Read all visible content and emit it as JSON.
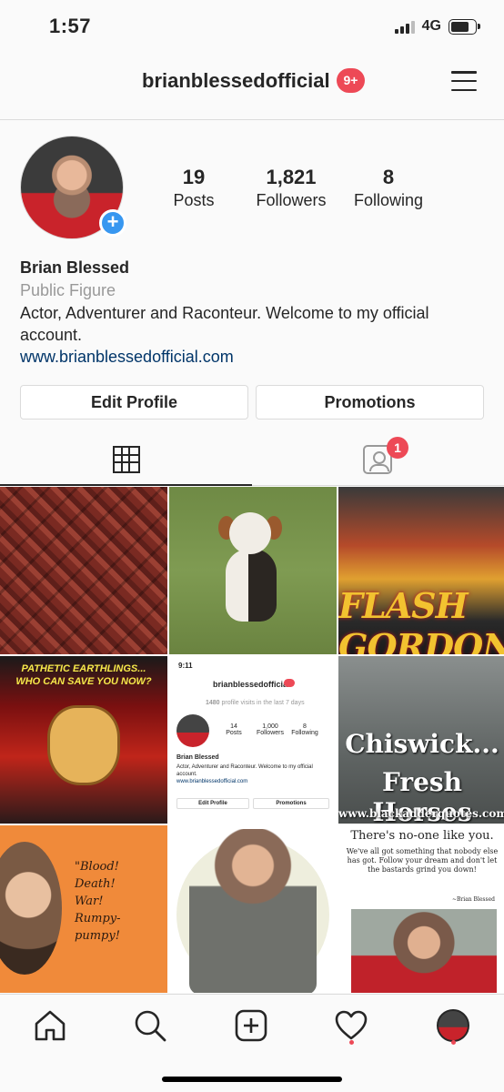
{
  "status_bar": {
    "time": "1:57",
    "network": "4G"
  },
  "header": {
    "username": "brianblessedofficial",
    "notifications_badge": "9+"
  },
  "profile": {
    "stats": [
      {
        "value": "19",
        "label": "Posts"
      },
      {
        "value": "1,821",
        "label": "Followers"
      },
      {
        "value": "8",
        "label": "Following"
      }
    ],
    "name": "Brian Blessed",
    "category": "Public Figure",
    "bio": "Actor, Adventurer and Raconteur. Welcome to my official account.",
    "website": "www.brianblessedofficial.com"
  },
  "buttons": {
    "edit_profile": "Edit Profile",
    "promotions": "Promotions"
  },
  "tabs": {
    "tagged_badge": "1"
  },
  "posts": {
    "flash_gordon_text": "FLASH GORDON",
    "ming_poster_line1": "PATHETIC EARTHLINGS...",
    "ming_poster_line2": "WHO CAN SAVE YOU NOW?",
    "screenshot": {
      "time": "9:11",
      "username": "brianblessedofficial",
      "visits_count": "1480",
      "visits_text": "profile visits in the last 7 days",
      "stats": [
        {
          "value": "14",
          "label": "Posts"
        },
        {
          "value": "1,000",
          "label": "Followers"
        },
        {
          "value": "8",
          "label": "Following"
        }
      ],
      "name": "Brian Blessed",
      "bio": "Actor, Adventurer and Raconteur. Welcome to my official account.",
      "website": "www.brianblessedofficial.com",
      "edit_profile": "Edit Profile",
      "promotions": "Promotions"
    },
    "chiswick_line1": "Chiswick...",
    "chiswick_line2": "Fresh Horses",
    "chiswick_url": "www.blackadderquotes.com",
    "quote_lines": [
      "\"Blood!",
      "Death!",
      "War!",
      "Rumpy-pumpy!"
    ],
    "noone_title": "There's no-one like you.",
    "noone_body": "We've all got something that nobody else has got. Follow your dream and don't let the bastards grind you down!",
    "noone_sig": "~Brian Blessed"
  },
  "icons": {
    "menu": "hamburger-icon",
    "grid": "grid-icon",
    "tagged": "tagged-person-icon",
    "home": "home-icon",
    "search": "search-icon",
    "add": "add-post-icon",
    "activity": "heart-icon",
    "profile": "profile-avatar-icon"
  },
  "colors": {
    "badge": "#ed4956",
    "link": "#003569",
    "add_photo": "#3897f0"
  }
}
